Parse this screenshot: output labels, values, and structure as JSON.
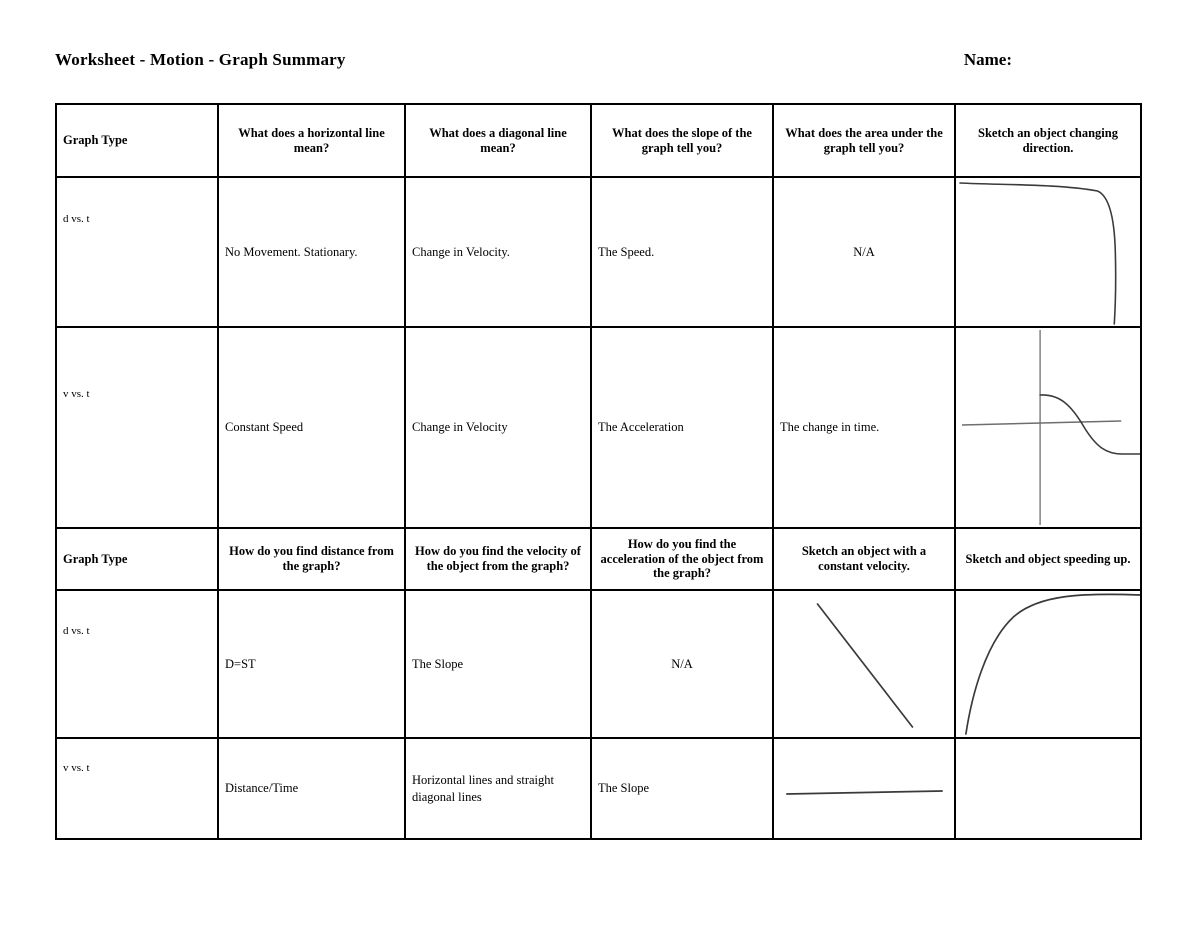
{
  "document": {
    "title": "Worksheet - Motion - Graph Summary",
    "name_label": "Name:"
  },
  "table": {
    "header_1": [
      "Graph Type",
      "What does a horizontal line mean?",
      "What does a diagonal line mean?",
      "What does the slope of the graph tell you?",
      "What does the area under the graph tell you?",
      "Sketch an object changing direction."
    ],
    "row_1": {
      "graph_type": "d vs. t",
      "horizontal_line": "No Movement. Stationary.",
      "diagonal_line": "Change in Velocity.",
      "slope": "The Speed.",
      "area_under": "N/A",
      "sketch": "curve-flat-then-drop"
    },
    "row_2": {
      "graph_type": "v vs. t",
      "horizontal_line": "Constant Speed",
      "diagonal_line": "Change in Velocity",
      "slope": "The Acceleration",
      "area_under": "The change in time.",
      "sketch": "axes-with-descending-s-curve"
    },
    "header_2": [
      "Graph Type",
      "How do you find distance from the graph?",
      "How do you find the velocity of the object from the graph?",
      "How do you find the acceleration of the object from the graph?",
      "Sketch an object with a constant velocity.",
      "Sketch and object speeding up."
    ],
    "row_3": {
      "graph_type": "d vs. t",
      "find_distance": "D=ST",
      "find_velocity": "The Slope",
      "find_acceleration": "N/A",
      "sketch_constant_velocity": "descending-straight-line",
      "sketch_speeding_up": "rising-concave-down-curve"
    },
    "row_4": {
      "graph_type": "v vs. t",
      "find_distance": "Distance/Time",
      "find_velocity": "Horizontal lines and straight diagonal lines",
      "find_acceleration": "The Slope",
      "sketch_constant_velocity": "horizontal-line",
      "sketch_speeding_up": ""
    }
  },
  "colors": {
    "ink": "#000000",
    "paper": "#ffffff",
    "sketch_stroke": "#3a3a3a"
  }
}
